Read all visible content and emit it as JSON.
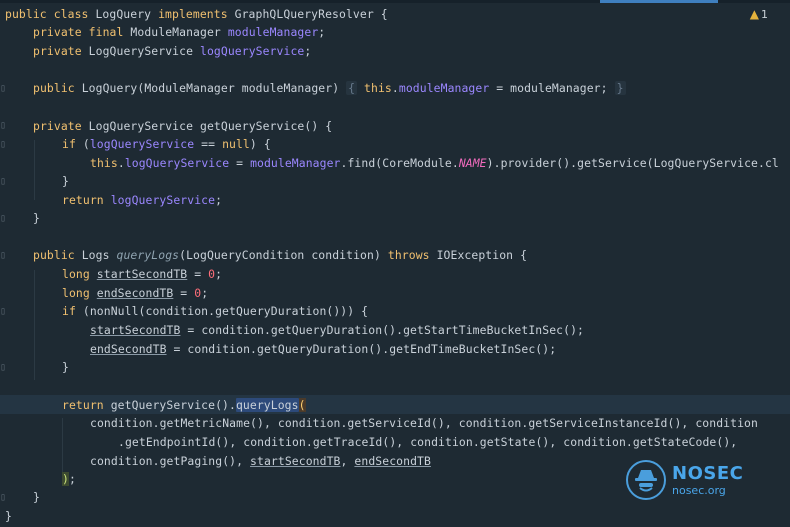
{
  "editor": {
    "warning_icon": "warning-triangle-icon",
    "warning_glyph": "▲",
    "warning_count": "1",
    "accent_color": "#3f7fbf"
  },
  "code": {
    "l1": {
      "t1": "public class ",
      "t2": "LogQuery ",
      "t3": "implements ",
      "t4": "GraphQLQueryResolver {"
    },
    "l2": {
      "t1": "private final ",
      "t2": "ModuleManager ",
      "t3": "moduleManager",
      "t4": ";"
    },
    "l3": {
      "t1": "private ",
      "t2": "LogQueryService ",
      "t3": "logQueryService",
      "t4": ";"
    },
    "l4": {
      "t1": "public ",
      "t2": "LogQuery(ModuleManager moduleManager) ",
      "t3": "{",
      "t4": " this",
      "t5": ".",
      "t6": "moduleManager",
      "t7": " = moduleManager; ",
      "t8": "}"
    },
    "l5": {
      "t1": "private ",
      "t2": "LogQueryService getQueryService() {"
    },
    "l6": {
      "t1": "if ",
      "t2": "(",
      "t3": "logQueryService",
      "t4": " == ",
      "t5": "null",
      "t6": ") {"
    },
    "l7": {
      "t1": "this",
      "t2": ".",
      "t3": "logQueryService",
      "t4": " = ",
      "t5": "moduleManager",
      "t6": ".find(CoreModule.",
      "t7": "NAME",
      "t8": ").provider().getService(LogQueryService.cl"
    },
    "l8": {
      "t1": "}"
    },
    "l9": {
      "t1": "return ",
      "t2": "logQueryService",
      "t3": ";"
    },
    "l10": {
      "t1": "}"
    },
    "l11": {
      "t1": "public ",
      "t2": "Logs ",
      "t3": "queryLogs",
      "t4": "(LogQueryCondition condition) ",
      "t5": "throws ",
      "t6": "IOException {"
    },
    "l12": {
      "t1": "long ",
      "t2": "startSecondTB",
      "t3": " = ",
      "t4": "0",
      "t5": ";"
    },
    "l13": {
      "t1": "long ",
      "t2": "endSecondTB",
      "t3": " = ",
      "t4": "0",
      "t5": ";"
    },
    "l14": {
      "t1": "if ",
      "t2": "(nonNull(condition.getQueryDuration())) {"
    },
    "l15": {
      "t1": "startSecondTB",
      "t2": " = condition.getQueryDuration().getStartTimeBucketInSec();"
    },
    "l16": {
      "t1": "endSecondTB",
      "t2": " = condition.getQueryDuration().getEndTimeBucketInSec();"
    },
    "l17": {
      "t1": "}"
    },
    "l18": {
      "t1": "return ",
      "t2": "getQueryService().",
      "t3": "queryLogs",
      "t4": "("
    },
    "l19": {
      "t1": "condition.getMetricName(), condition.getServiceId(), condition.getServiceInstanceId(), condition"
    },
    "l20": {
      "t1": ".getEndpointId(), condition.getTraceId(), condition.getState(), condition.getStateCode(),"
    },
    "l21": {
      "t1": "condition.getPaging(), ",
      "t2": "startSecondTB",
      "t3": ", ",
      "t4": "endSecondTB"
    },
    "l22": {
      "t1": ")",
      "t2": ";"
    },
    "l23": {
      "t1": "}"
    },
    "l24": {
      "t1": "}"
    }
  },
  "watermark": {
    "icon": "spy-hat-logo-icon",
    "title": "NOSEC",
    "subtitle": "nosec.org"
  }
}
